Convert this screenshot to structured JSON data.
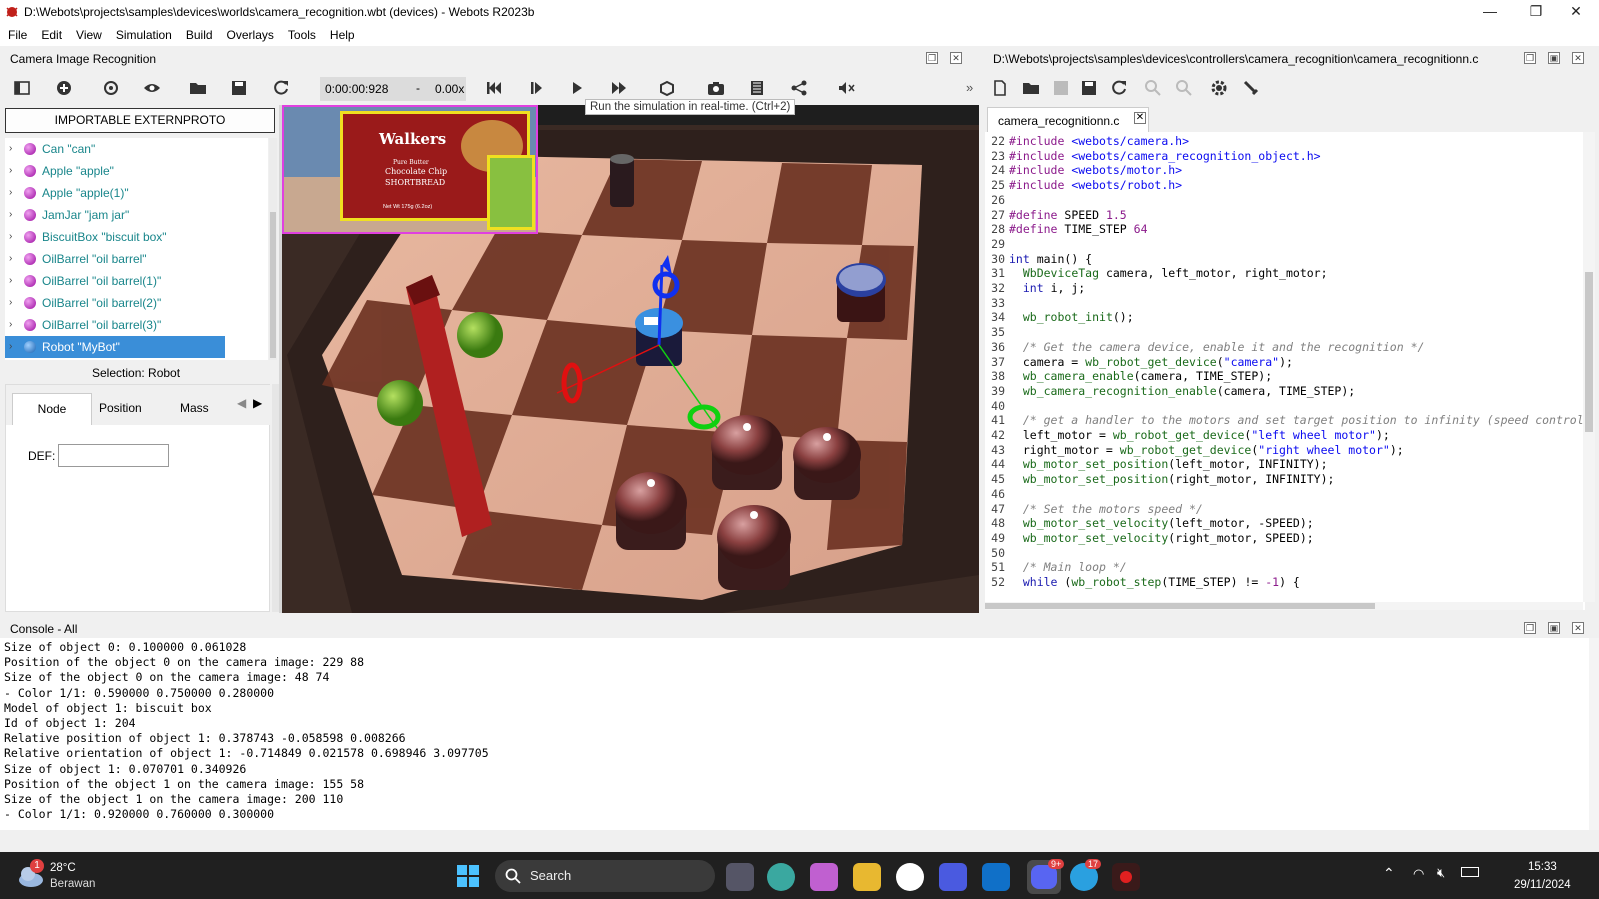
{
  "window": {
    "title": "D:\\Webots\\projects\\samples\\devices\\worlds\\camera_recognition.wbt (devices) - Webots R2023b",
    "minimize": "—",
    "maximize": "❐",
    "close": "✕"
  },
  "menu": [
    "File",
    "Edit",
    "View",
    "Simulation",
    "Build",
    "Overlays",
    "Tools",
    "Help"
  ],
  "left_panel": {
    "title": "Camera Image Recognition",
    "import_button": "IMPORTABLE EXTERNPROTO",
    "tree": [
      {
        "label": "Can \"can\""
      },
      {
        "label": "Apple \"apple\""
      },
      {
        "label": "Apple \"apple(1)\""
      },
      {
        "label": "JamJar \"jam jar\""
      },
      {
        "label": "BiscuitBox \"biscuit box\""
      },
      {
        "label": "OilBarrel \"oil barrel\""
      },
      {
        "label": "OilBarrel \"oil barrel(1)\""
      },
      {
        "label": "OilBarrel \"oil barrel(2)\""
      },
      {
        "label": "OilBarrel \"oil barrel(3)\""
      },
      {
        "label": "Robot \"MyBot\"",
        "selected": true
      }
    ],
    "selection": "Selection: Robot",
    "tabs": [
      "Node",
      "Position",
      "Mass"
    ],
    "def_label": "DEF:",
    "def_value": ""
  },
  "toolbar": {
    "time": "0:00:00:928",
    "speed_sep": "-",
    "speed": "0.00x",
    "tooltip": "Run the simulation in real-time. (Ctrl+2)",
    "more": "»"
  },
  "viewport": {
    "biscuit_brand": "Walkers",
    "biscuit_sub1": "Pure Butter",
    "biscuit_sub2": "Chocolate Chip",
    "biscuit_sub3": "SHORTBREAD",
    "biscuit_weight": "Net Wt 175g (6.2oz)"
  },
  "editor_panel": {
    "title": "D:\\Webots\\projects\\samples\\devices\\controllers\\camera_recognition\\camera_recognitionn.c",
    "tab": "camera_recognitionn.c",
    "tab_close": "✕",
    "lines": [
      {
        "n": "22",
        "t": "#include <webots/camera.h>"
      },
      {
        "n": "23",
        "t": "#include <webots/camera_recognition_object.h>"
      },
      {
        "n": "24",
        "t": "#include <webots/motor.h>"
      },
      {
        "n": "25",
        "t": "#include <webots/robot.h>"
      },
      {
        "n": "26",
        "t": ""
      },
      {
        "n": "27",
        "t": "#define SPEED 1.5"
      },
      {
        "n": "28",
        "t": "#define TIME_STEP 64"
      },
      {
        "n": "29",
        "t": ""
      },
      {
        "n": "30",
        "t": "int main() {"
      },
      {
        "n": "31",
        "t": "  WbDeviceTag camera, left_motor, right_motor;"
      },
      {
        "n": "32",
        "t": "  int i, j;"
      },
      {
        "n": "33",
        "t": ""
      },
      {
        "n": "34",
        "t": "  wb_robot_init();"
      },
      {
        "n": "35",
        "t": ""
      },
      {
        "n": "36",
        "t": "  /* Get the camera device, enable it and the recognition */"
      },
      {
        "n": "37",
        "t": "  camera = wb_robot_get_device(\"camera\");"
      },
      {
        "n": "38",
        "t": "  wb_camera_enable(camera, TIME_STEP);"
      },
      {
        "n": "39",
        "t": "  wb_camera_recognition_enable(camera, TIME_STEP);"
      },
      {
        "n": "40",
        "t": ""
      },
      {
        "n": "41",
        "t": "  /* get a handler to the motors and set target position to infinity (speed control"
      },
      {
        "n": "42",
        "t": "  left_motor = wb_robot_get_device(\"left wheel motor\");"
      },
      {
        "n": "43",
        "t": "  right_motor = wb_robot_get_device(\"right wheel motor\");"
      },
      {
        "n": "44",
        "t": "  wb_motor_set_position(left_motor, INFINITY);"
      },
      {
        "n": "45",
        "t": "  wb_motor_set_position(right_motor, INFINITY);"
      },
      {
        "n": "46",
        "t": ""
      },
      {
        "n": "47",
        "t": "  /* Set the motors speed */"
      },
      {
        "n": "48",
        "t": "  wb_motor_set_velocity(left_motor, -SPEED);"
      },
      {
        "n": "49",
        "t": "  wb_motor_set_velocity(right_motor, SPEED);"
      },
      {
        "n": "50",
        "t": ""
      },
      {
        "n": "51",
        "t": "  /* Main loop */"
      },
      {
        "n": "52",
        "t": "  while (wb_robot_step(TIME_STEP) != -1) {"
      }
    ]
  },
  "console": {
    "title": "Console - All",
    "lines": [
      "Size of object 0: 0.100000 0.061028",
      "Position of the object 0 on the camera image: 229 88",
      "Size of the object 0 on the camera image: 48 74",
      "- Color 1/1: 0.590000 0.750000 0.280000",
      "Model of object 1: biscuit box",
      "Id of object 1: 204",
      "Relative position of object 1: 0.378743 -0.058598 0.008266",
      "Relative orientation of object 1: -0.714849 0.021578 0.698946 3.097705",
      "Size of object 1: 0.070701 0.340926",
      "Position of the object 1 on the camera image: 155 58",
      "Size of the object 1 on the camera image: 200 110",
      "- Color 1/1: 0.920000 0.760000 0.300000"
    ]
  },
  "taskbar": {
    "weather_badge": "1",
    "temp": "28°C",
    "weather": "Berawan",
    "search": "Search",
    "discord_badge": "9+",
    "telegram_badge": "17",
    "time": "15:33",
    "date": "29/11/2024"
  },
  "colors": {
    "accent": "#3a8ed8",
    "tree_text": "#19868b",
    "taskbar": "#202020"
  }
}
